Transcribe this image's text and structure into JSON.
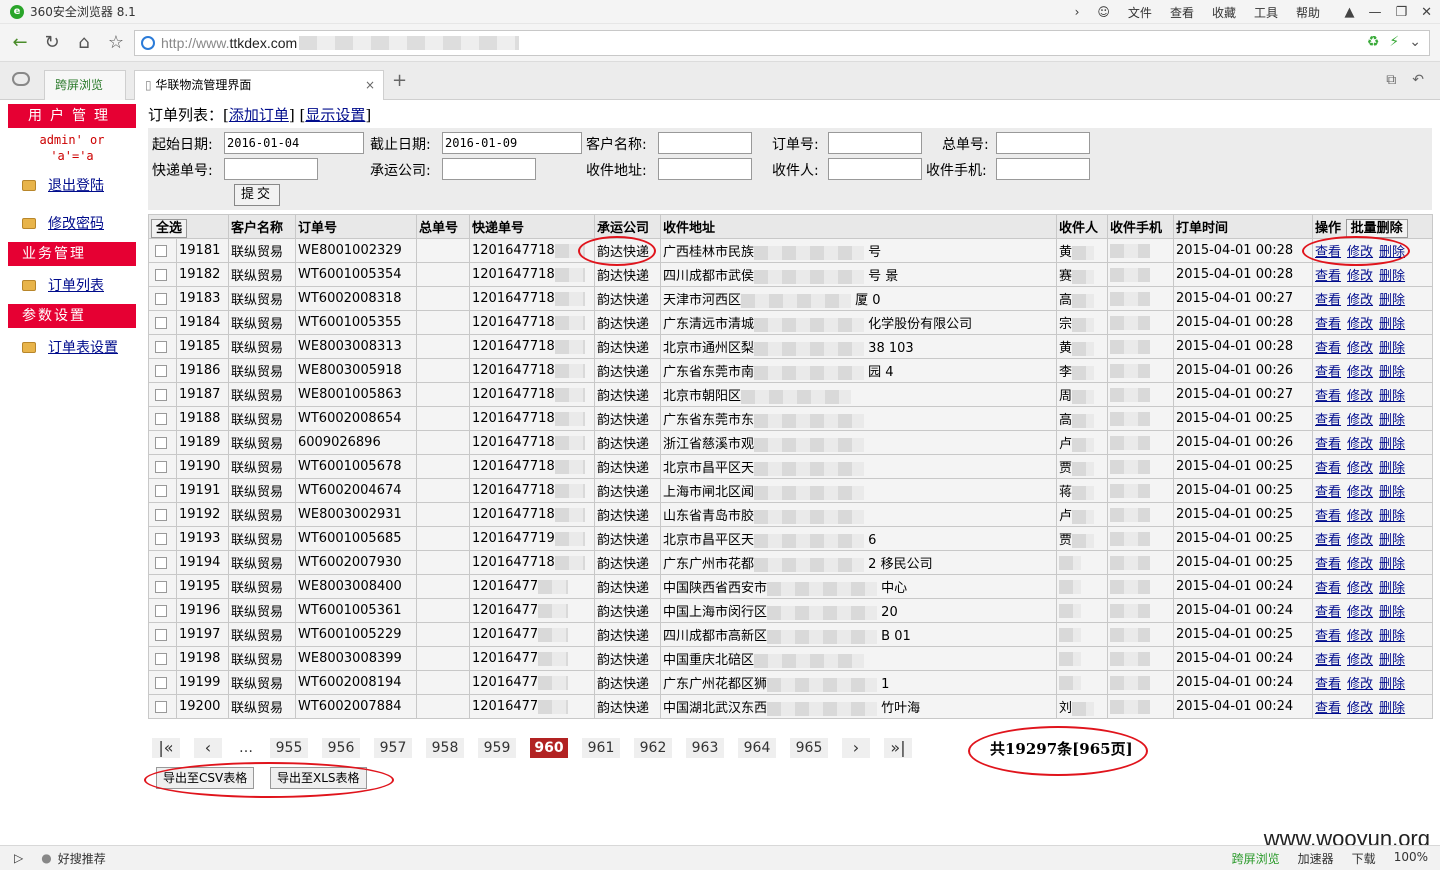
{
  "browser": {
    "title": "360安全浏览器 8.1",
    "menu": [
      "文件",
      "查看",
      "收藏",
      "工具",
      "帮助"
    ],
    "url_prefix": "http://www.",
    "url_domain": "ttkdex.com",
    "tabs": [
      {
        "label": "跨屏浏览"
      },
      {
        "label": "华联物流管理界面"
      }
    ]
  },
  "sidebar": {
    "user_mgmt": "用户管理",
    "admin_line1": "admin' or",
    "admin_line2": "'a'='a",
    "logout": "退出登陆",
    "change_pw": "修改密码",
    "biz_mgmt": "业务管理",
    "order_list": "订单列表",
    "params": "参数设置",
    "order_settings": "订单表设置"
  },
  "page": {
    "heading_prefix": "订单列表：[",
    "add_order": "添加订单",
    "heading_mid": "] [",
    "display_settings": "显示设置",
    "heading_suffix": "]"
  },
  "filters": {
    "start_date_label": "起始日期:",
    "start_date": "2016-01-04",
    "end_date_label": "截止日期:",
    "end_date": "2016-01-09",
    "customer_label": "客户名称:",
    "order_no_label": "订单号:",
    "master_no_label": "总单号:",
    "express_no_label": "快递单号:",
    "carrier_label": "承运公司:",
    "address_label": "收件地址:",
    "recipient_label": "收件人:",
    "phone_label": "收件手机:",
    "submit": "提交"
  },
  "table": {
    "select_all": "全选",
    "batch_delete": "批量删除",
    "headers": [
      "客户名称",
      "订单号",
      "总单号",
      "快递单号",
      "承运公司",
      "收件地址",
      "收件人",
      "收件手机",
      "打单时间",
      "操作"
    ],
    "actions": [
      "查看",
      "修改",
      "删除"
    ],
    "rows": [
      {
        "id": "19181",
        "customer": "联纵贸易",
        "order": "WE8001002329",
        "express": "1201647718",
        "carrier": "韵达快递",
        "addr": "广西桂林市民族",
        "addr2": "号",
        "name": "黄",
        "time": "2015-04-01 00:28"
      },
      {
        "id": "19182",
        "customer": "联纵贸易",
        "order": "WT6001005354",
        "express": "1201647718",
        "carrier": "韵达快递",
        "addr": "四川成都市武侯",
        "addr2": "号 景",
        "name": "赛",
        "time": "2015-04-01 00:28"
      },
      {
        "id": "19183",
        "customer": "联纵贸易",
        "order": "WT6002008318",
        "express": "1201647718",
        "carrier": "韵达快递",
        "addr": "天津市河西区",
        "addr2": "厦 0",
        "name": "高",
        "time": "2015-04-01 00:27"
      },
      {
        "id": "19184",
        "customer": "联纵贸易",
        "order": "WT6001005355",
        "express": "1201647718",
        "carrier": "韵达快递",
        "addr": "广东清远市清城",
        "addr2": "化学股份有限公司",
        "name": "宗",
        "time": "2015-04-01 00:28"
      },
      {
        "id": "19185",
        "customer": "联纵贸易",
        "order": "WE8003008313",
        "express": "1201647718",
        "carrier": "韵达快递",
        "addr": "北京市通州区梨",
        "addr2": "38 103",
        "name": "黄",
        "time": "2015-04-01 00:28"
      },
      {
        "id": "19186",
        "customer": "联纵贸易",
        "order": "WE8003005918",
        "express": "1201647718",
        "carrier": "韵达快递",
        "addr": "广东省东莞市南",
        "addr2": "园 4",
        "name": "李",
        "time": "2015-04-01 00:26"
      },
      {
        "id": "19187",
        "customer": "联纵贸易",
        "order": "WE8001005863",
        "express": "1201647718",
        "carrier": "韵达快递",
        "addr": "北京市朝阳区",
        "addr2": "",
        "name": "周",
        "time": "2015-04-01 00:27"
      },
      {
        "id": "19188",
        "customer": "联纵贸易",
        "order": "WT6002008654",
        "express": "1201647718",
        "carrier": "韵达快递",
        "addr": "广东省东莞市东",
        "addr2": "",
        "name": "高",
        "time": "2015-04-01 00:25"
      },
      {
        "id": "19189",
        "customer": "联纵贸易",
        "order": "6009026896",
        "express": "1201647718",
        "carrier": "韵达快递",
        "addr": "浙江省慈溪市观",
        "addr2": "",
        "name": "卢",
        "time": "2015-04-01 00:26"
      },
      {
        "id": "19190",
        "customer": "联纵贸易",
        "order": "WT6001005678",
        "express": "1201647718",
        "carrier": "韵达快递",
        "addr": "北京市昌平区天",
        "addr2": "",
        "name": "贾",
        "time": "2015-04-01 00:25"
      },
      {
        "id": "19191",
        "customer": "联纵贸易",
        "order": "WT6002004674",
        "express": "1201647718",
        "carrier": "韵达快递",
        "addr": "上海市闸北区闻",
        "addr2": "",
        "name": "蒋",
        "time": "2015-04-01 00:25"
      },
      {
        "id": "19192",
        "customer": "联纵贸易",
        "order": "WE8003002931",
        "express": "1201647718",
        "carrier": "韵达快递",
        "addr": "山东省青岛市胶",
        "addr2": "",
        "name": "卢",
        "time": "2015-04-01 00:25"
      },
      {
        "id": "19193",
        "customer": "联纵贸易",
        "order": "WT6001005685",
        "express": "1201647719",
        "carrier": "韵达快递",
        "addr": "北京市昌平区天",
        "addr2": "6",
        "name": "贾",
        "time": "2015-04-01 00:25"
      },
      {
        "id": "19194",
        "customer": "联纵贸易",
        "order": "WT6002007930",
        "express": "1201647718",
        "carrier": "韵达快递",
        "addr": "广东广州市花都",
        "addr2": "2 移民公司",
        "name": "",
        "time": "2015-04-01 00:25"
      },
      {
        "id": "19195",
        "customer": "联纵贸易",
        "order": "WE8003008400",
        "express": "12016477",
        "carrier": "韵达快递",
        "addr": "中国陕西省西安市",
        "addr2": "中心",
        "name": "",
        "time": "2015-04-01 00:24"
      },
      {
        "id": "19196",
        "customer": "联纵贸易",
        "order": "WT6001005361",
        "express": "12016477",
        "carrier": "韵达快递",
        "addr": "中国上海市闵行区",
        "addr2": "20",
        "name": "",
        "time": "2015-04-01 00:24"
      },
      {
        "id": "19197",
        "customer": "联纵贸易",
        "order": "WT6001005229",
        "express": "12016477",
        "carrier": "韵达快递",
        "addr": "四川成都市高新区",
        "addr2": "B 01",
        "name": "",
        "time": "2015-04-01 00:25"
      },
      {
        "id": "19198",
        "customer": "联纵贸易",
        "order": "WE8003008399",
        "express": "12016477",
        "carrier": "韵达快递",
        "addr": "中国重庆北碚区",
        "addr2": "",
        "name": "",
        "time": "2015-04-01 00:24"
      },
      {
        "id": "19199",
        "customer": "联纵贸易",
        "order": "WT6002008194",
        "express": "12016477",
        "carrier": "韵达快递",
        "addr": "广东广州花都区狮",
        "addr2": "1",
        "name": "",
        "time": "2015-04-01 00:24"
      },
      {
        "id": "19200",
        "customer": "联纵贸易",
        "order": "WT6002007884",
        "express": "12016477",
        "carrier": "韵达快递",
        "addr": "中国湖北武汉东西",
        "addr2": "竹叶海",
        "name": "刘",
        "time": "2015-04-01 00:24"
      }
    ]
  },
  "pager": {
    "ellipsis": "…",
    "pages": [
      "955",
      "956",
      "957",
      "958",
      "959",
      "960",
      "961",
      "962",
      "963",
      "964",
      "965"
    ],
    "current": "960",
    "total": "共19297条[965页]"
  },
  "export": {
    "csv": "导出至CSV表格",
    "xls": "导出至XLS表格"
  },
  "statusbar": {
    "recommend": "好搜推荐",
    "items": [
      "跨屏浏览",
      "加速器",
      "下载",
      "100%"
    ],
    "watermark": "www.wooyun.org"
  }
}
